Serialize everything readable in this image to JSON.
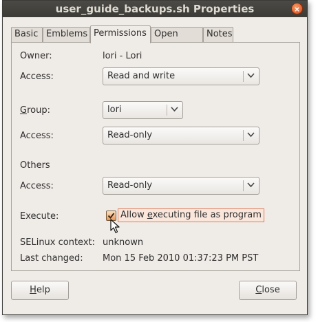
{
  "window": {
    "title": "user_guide_backups.sh Properties",
    "close_glyph": "×"
  },
  "tabs": [
    {
      "label": "Basic"
    },
    {
      "label": "Emblems"
    },
    {
      "label": "Permissions",
      "active": true
    },
    {
      "label": "Open With"
    },
    {
      "label": "Notes"
    }
  ],
  "owner": {
    "label": "Owner:",
    "value": "lori - Lori"
  },
  "owner_access": {
    "label": "Access:",
    "value": "Read and write"
  },
  "group": {
    "label_pre": "",
    "label_mnemonic": "G",
    "label_post": "roup:",
    "value": "lori"
  },
  "group_access": {
    "label": "Access:",
    "value": "Read-only"
  },
  "others": {
    "heading": "Others",
    "access_label": "Access:",
    "access_value": "Read-only"
  },
  "execute": {
    "label": "Execute:",
    "checkbox_pre": "Allow ",
    "checkbox_mnemonic": "e",
    "checkbox_post": "xecuting file as program",
    "checked": true
  },
  "selinux": {
    "label": "SELinux context:",
    "value": "unknown"
  },
  "last_changed": {
    "label": "Last changed:",
    "value": "Mon 15 Feb 2010 01:37:23 PM PST"
  },
  "buttons": {
    "help": {
      "mnemonic": "H",
      "rest": "elp"
    },
    "close": {
      "mnemonic": "C",
      "rest": "lose"
    }
  },
  "icons": {
    "dropdown": "chevron-down-icon",
    "check": "checkmark-icon",
    "cursor": "mouse-pointer-icon"
  }
}
